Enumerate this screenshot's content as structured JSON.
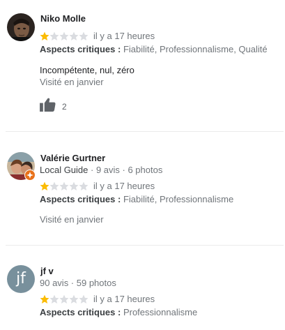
{
  "colors": {
    "star_filled": "#fbbc04",
    "star_empty": "#dadce0",
    "local_guide_badge": "#e8711a",
    "initials_avatar_bg": "#78909c"
  },
  "reviews": [
    {
      "name": "Niko Molle",
      "avatar_icon": "user-photo",
      "rating": 1,
      "rating_max": 5,
      "time": "il y a 17 heures",
      "aspects_label": "Aspects critiques :",
      "aspects": "Fiabilité, Professionnalisme, Qualité",
      "text": "Incompétente, nul, zéro",
      "visited": "Visité en janvier",
      "like_icon": "thumb-up-icon",
      "likes": "2"
    },
    {
      "name": "Valérie Gurtner",
      "avatar_icon": "user-photo",
      "local_guide": "Local Guide",
      "stats": " · 9 avis · 6 photos",
      "rating": 1,
      "rating_max": 5,
      "time": "il y a 17 heures",
      "aspects_label": "Aspects critiques :",
      "aspects": "Fiabilité, Professionnalisme",
      "visited": "Visité en janvier"
    },
    {
      "name": "jf v",
      "avatar_initials": "jf",
      "stats": "90 avis · 59 photos",
      "rating": 1,
      "rating_max": 5,
      "time": "il y a 17 heures",
      "aspects_label": "Aspects critiques :",
      "aspects": "Professionnalisme"
    }
  ]
}
